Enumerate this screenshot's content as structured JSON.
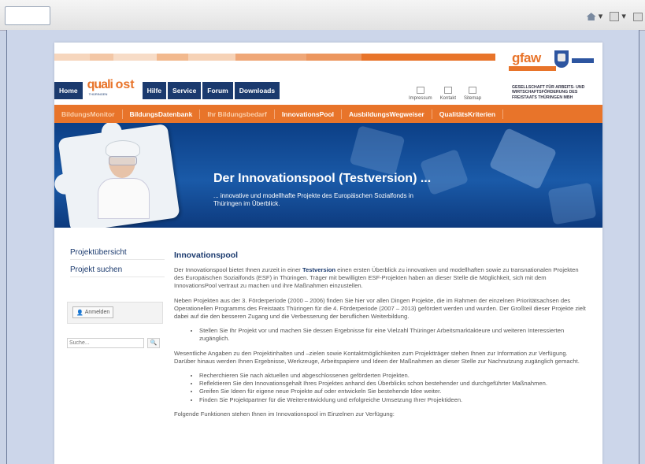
{
  "browser": {
    "toolbar_icons": [
      "home-icon",
      "feed-icon",
      "print-icon"
    ]
  },
  "header": {
    "gfaw_logo_text": "gfaw",
    "gfaw_subtitle": "GESELLSCHAFT FÜR ARBEITS- UND WIRTSCHAFTSFÖRDERUNG DES FREISTAATS THÜRINGEN MBH",
    "quali_logo_text_1": "quali",
    "quali_logo_text_2": "ost",
    "quali_logo_small": "THÜRINGEN",
    "nav": [
      {
        "label": "Home"
      },
      {
        "label": "Hilfe"
      },
      {
        "label": "Service"
      },
      {
        "label": "Forum"
      },
      {
        "label": "Downloads"
      }
    ],
    "util_links": [
      {
        "label": "Impressum",
        "icon": "info-icon"
      },
      {
        "label": "Kontakt",
        "icon": "mail-icon"
      },
      {
        "label": "Sitemap",
        "icon": "sitemap-icon"
      }
    ],
    "subnav": [
      {
        "label": "BildungsMonitor"
      },
      {
        "label": "BildungsDatenbank"
      },
      {
        "label": "Ihr Bildungsbedarf"
      },
      {
        "label": "InnovationsPool"
      },
      {
        "label": "AusbildungsWegweiser"
      },
      {
        "label": "QualitätsKriterien"
      }
    ]
  },
  "hero": {
    "title": "Der Innovationspool (Testversion) ...",
    "subtitle": "... innovative und modellhafte Projekte des Europäischen Sozialfonds in Thüringen im Überblick."
  },
  "sidebar": {
    "links": [
      {
        "label": "Projektübersicht"
      },
      {
        "label": "Projekt suchen"
      }
    ],
    "login_label": "Anmelden",
    "search_placeholder": "Suche..."
  },
  "content": {
    "heading": "Innovationspool",
    "p1_before": "Der Innovationspool bietet Ihnen zurzeit in einer ",
    "p1_highlight": "Testversion",
    "p1_after": " einen ersten Überblick zu innovativen und modellhaften sowie zu transnationalen Projekten des Europäischen Sozialfonds (ESF) in Thüringen. Träger mit bewilligten ESF-Projekten haben an dieser Stelle die Möglichkeit, sich mit dem InnovationsPool vertraut zu machen und ihre Maßnahmen einzustellen.",
    "p2": "Neben Projekten aus der 3. Förderperiode (2000 – 2006) finden Sie hier vor allen Dingen Projekte, die im Rahmen der einzelnen Prioritätsachsen des Operationellen Programms des Freistaats Thüringen für die 4. Förderperiode (2007 – 2013) gefördert werden und wurden. Der Großteil dieser  Projekte zielt dabei auf die den besseren Zugang und die Verbesserung der beruflichen Weiterbildung.",
    "list1": [
      "Stellen Sie Ihr Projekt vor und machen Sie dessen Ergebnisse für eine Vielzahl Thüringer Arbeitsmarktakteure und weiteren Interessierten zugänglich."
    ],
    "p3": "Wesentliche Angaben zu den Projektinhalten und –zielen sowie Kontaktmöglichkeiten zum Projektträger stehen Ihnen zur Information zur Verfügung. Darüber hinaus werden Ihnen Ergebnisse, Werkzeuge, Arbeitspapiere und Ideen der Maßnahmen an dieser Stelle zur Nachnutzung zugänglich gemacht.",
    "list2": [
      "Recherchieren Sie nach aktuellen und abgeschlossenen geförderten Projekten.",
      "Reflektieren Sie den Innovationsgehalt Ihres Projektes anhand des Überblicks schon bestehender und durchgeführter Maßnahmen.",
      "Greifen Sie Ideen für eigene neue Projekte auf oder entwickeln Sie bestehende Idee weiter.",
      "Finden Sie Projektpartner für die Weiterentwicklung und erfolgreiche Umsetzung Ihrer Projektideen."
    ],
    "p4": "Folgende Funktionen stehen Ihnen im Innovationspool im Einzelnen zur Verfügung:"
  },
  "colors": {
    "orange": "#e8742a",
    "navy": "#1b3a6e",
    "hero_blue": "#1a5aa8"
  }
}
